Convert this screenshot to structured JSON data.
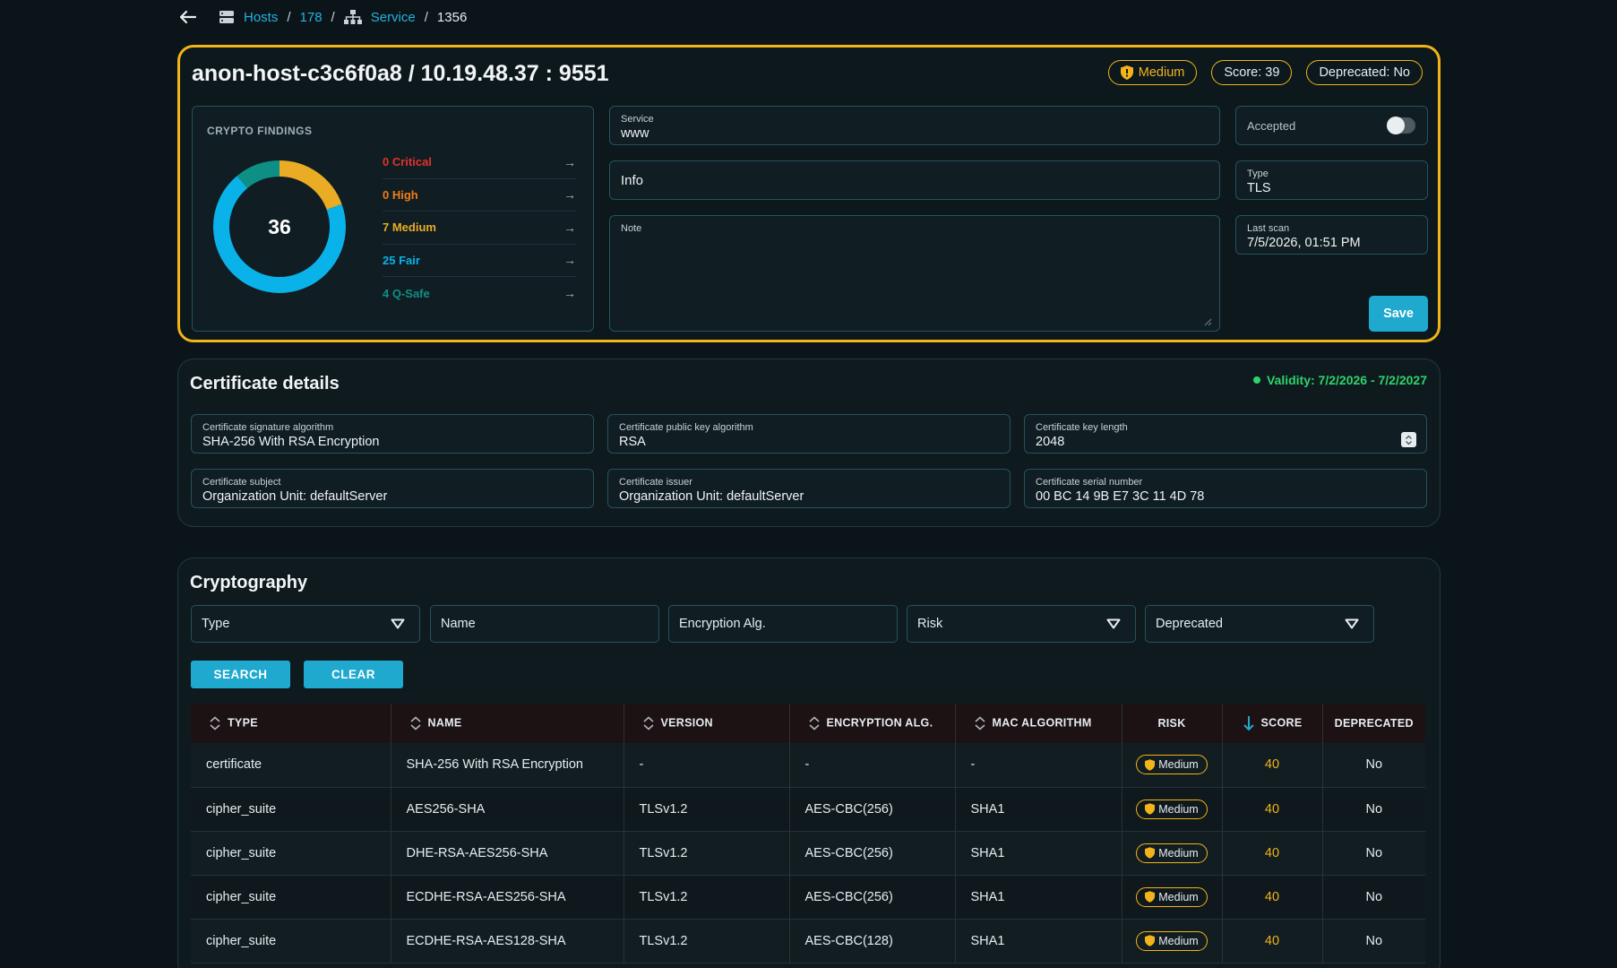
{
  "breadcrumb": {
    "hosts": "Hosts",
    "host_id": "178",
    "service": "Service",
    "service_id": "1356",
    "sep": "/"
  },
  "host": {
    "title": "anon-host-c3c6f0a8 / 10.19.48.37 : 9551",
    "risk_badge": "Medium",
    "score_badge": "Score: 39",
    "deprecated_badge": "Deprecated: No"
  },
  "findings": {
    "header": "CRYPTO FINDINGS",
    "total": "36",
    "rows": [
      {
        "label": "0 Critical",
        "value": 0,
        "color": "#e0332b"
      },
      {
        "label": "0 High",
        "value": 0,
        "color": "#f07d1a"
      },
      {
        "label": "7 Medium",
        "value": 7,
        "color": "#e9ac24"
      },
      {
        "label": "25 Fair",
        "value": 25,
        "color": "#0ab2ea"
      },
      {
        "label": "4 Q-Safe",
        "value": 4,
        "color": "#0e8f86"
      }
    ],
    "arrow": "→"
  },
  "form": {
    "service_label": "Service",
    "service_value": "www",
    "info_value": "Info",
    "note_label": "Note",
    "accepted_label": "Accepted",
    "type_label": "Type",
    "type_value": "TLS",
    "last_scan_label": "Last scan",
    "last_scan_value": "7/5/2026, 01:51 PM",
    "save_label": "Save"
  },
  "certificate": {
    "title": "Certificate details",
    "validity": "Validity:  7/2/2026 - 7/2/2027",
    "fields": {
      "sig_alg_label": "Certificate signature algorithm",
      "sig_alg_value": "SHA-256 With RSA Encryption",
      "pubkey_label": "Certificate public key algorithm",
      "pubkey_value": "RSA",
      "keylen_label": "Certificate key length",
      "keylen_value": "2048",
      "subject_label": "Certificate subject",
      "subject_value": "Organization Unit: defaultServer",
      "issuer_label": "Certificate issuer",
      "issuer_value": "Organization Unit: defaultServer",
      "serial_label": "Certificate serial number",
      "serial_value": "00 BC 14 9B E7 3C 11 4D 78"
    }
  },
  "crypto": {
    "title": "Cryptography",
    "filters": {
      "type": "Type",
      "name": "Name",
      "enc": "Encryption Alg.",
      "risk": "Risk",
      "deprecated": "Deprecated"
    },
    "search_label": "SEARCH",
    "clear_label": "CLEAR",
    "columns": {
      "type": "TYPE",
      "name": "NAME",
      "version": "VERSION",
      "enc": "ENCRYPTION ALG.",
      "mac": "MAC ALGORITHM",
      "risk": "RISK",
      "score": "SCORE",
      "deprecated": "DEPRECATED"
    },
    "rows": [
      {
        "type": "certificate",
        "name": "SHA-256 With RSA Encryption",
        "version": "-",
        "enc": "-",
        "mac": "-",
        "risk": "Medium",
        "score": "40",
        "deprecated": "No"
      },
      {
        "type": "cipher_suite",
        "name": "AES256-SHA",
        "version": "TLSv1.2",
        "enc": "AES-CBC(256)",
        "mac": "SHA1",
        "risk": "Medium",
        "score": "40",
        "deprecated": "No"
      },
      {
        "type": "cipher_suite",
        "name": "DHE-RSA-AES256-SHA",
        "version": "TLSv1.2",
        "enc": "AES-CBC(256)",
        "mac": "SHA1",
        "risk": "Medium",
        "score": "40",
        "deprecated": "No"
      },
      {
        "type": "cipher_suite",
        "name": "ECDHE-RSA-AES256-SHA",
        "version": "TLSv1.2",
        "enc": "AES-CBC(256)",
        "mac": "SHA1",
        "risk": "Medium",
        "score": "40",
        "deprecated": "No"
      },
      {
        "type": "cipher_suite",
        "name": "ECDHE-RSA-AES128-SHA",
        "version": "TLSv1.2",
        "enc": "AES-CBC(128)",
        "mac": "SHA1",
        "risk": "Medium",
        "score": "40",
        "deprecated": "No"
      }
    ]
  },
  "colors": {
    "accent": "#1fa9cf",
    "warning": "#f2b418",
    "success": "#2fd36b",
    "critical": "#e0332b",
    "high": "#f07d1a"
  },
  "icons": [
    "back-arrow-icon",
    "server-icon",
    "network-icon",
    "shield-icon",
    "sort-icon",
    "sort-down-icon",
    "chevron-down-icon",
    "spinner-icon"
  ]
}
